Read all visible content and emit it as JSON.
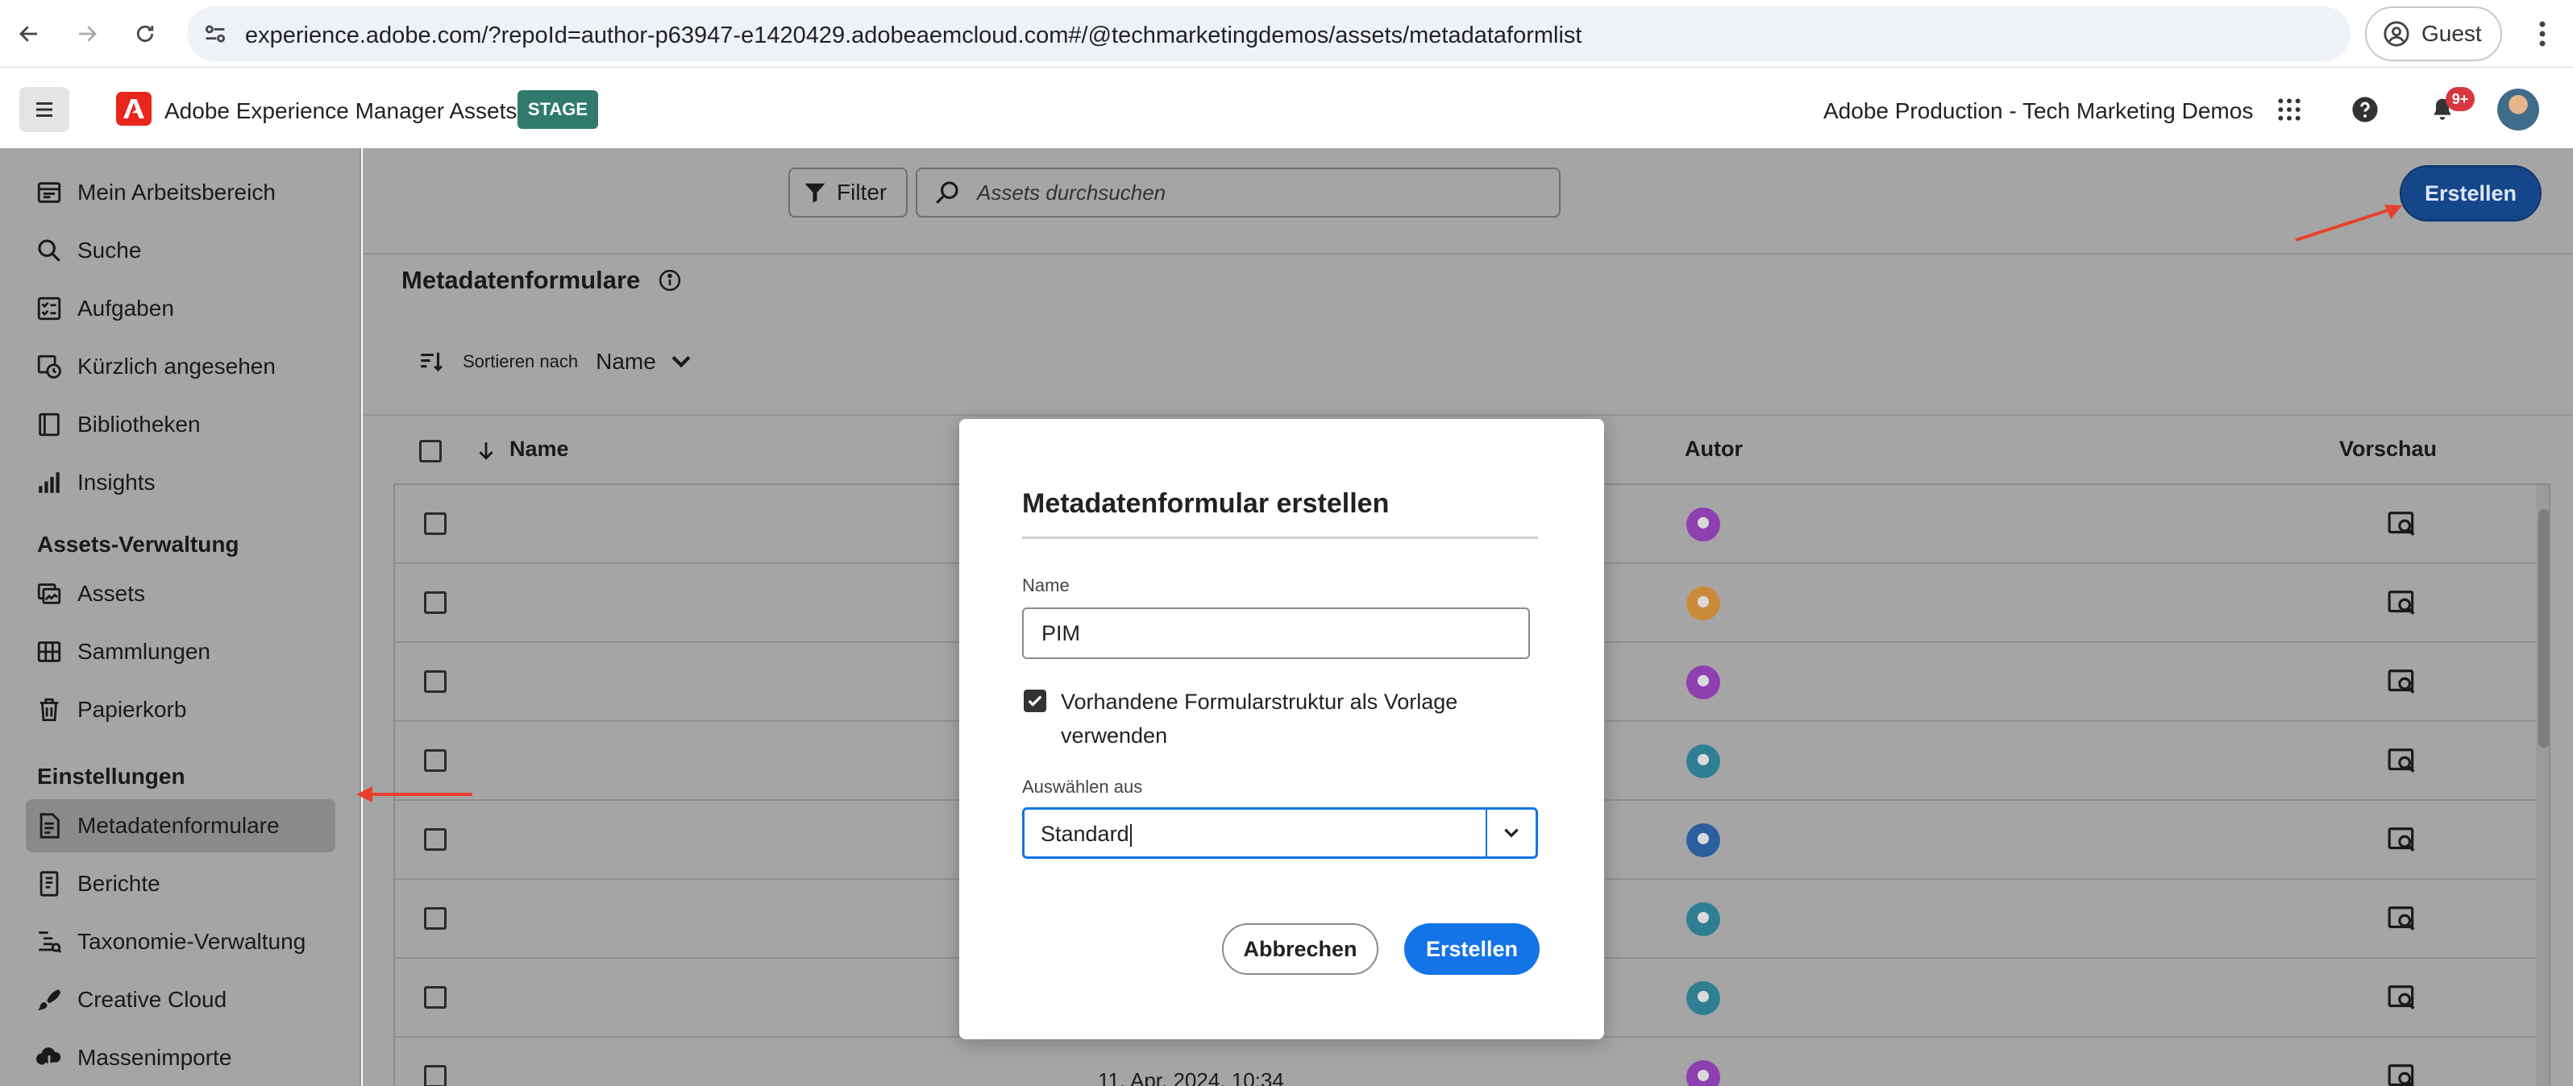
{
  "browser": {
    "url": "experience.adobe.com/?repoId=author-p63947-e1420429.adobeaemcloud.com#/@techmarketingdemos/assets/metadataformlist",
    "profile_label": "Guest"
  },
  "header": {
    "app_title": "Adobe Experience Manager Assets",
    "env_badge": "STAGE",
    "org_name": "Adobe Production - Tech Marketing Demos",
    "notification_count": "9+"
  },
  "sidebar": {
    "items_top": [
      {
        "label": "Mein Arbeitsbereich",
        "icon": "workspace-icon"
      },
      {
        "label": "Suche",
        "icon": "search-icon"
      },
      {
        "label": "Aufgaben",
        "icon": "tasks-icon"
      },
      {
        "label": "Kürzlich angesehen",
        "icon": "recent-icon"
      },
      {
        "label": "Bibliotheken",
        "icon": "library-icon"
      },
      {
        "label": "Insights",
        "icon": "insights-icon"
      }
    ],
    "section_assets": "Assets-Verwaltung",
    "items_assets": [
      {
        "label": "Assets",
        "icon": "assets-icon"
      },
      {
        "label": "Sammlungen",
        "icon": "collections-icon"
      },
      {
        "label": "Papierkorb",
        "icon": "trash-icon"
      }
    ],
    "section_settings": "Einstellungen",
    "items_settings": [
      {
        "label": "Metadatenformulare",
        "icon": "form-icon",
        "active": true
      },
      {
        "label": "Berichte",
        "icon": "reports-icon"
      },
      {
        "label": "Taxonomie-Verwaltung",
        "icon": "taxonomy-icon"
      },
      {
        "label": "Creative Cloud",
        "icon": "creative-cloud-icon"
      },
      {
        "label": "Massenimporte",
        "icon": "bulk-import-icon"
      }
    ]
  },
  "toolbar": {
    "filter_label": "Filter",
    "search_placeholder": "Assets durchsuchen",
    "create_label": "Erstellen"
  },
  "page": {
    "title": "Metadatenformulare",
    "sort_label": "Sortieren nach",
    "sort_value": "Name"
  },
  "table": {
    "columns": {
      "name": "Name",
      "author": "Autor",
      "preview": "Vorschau"
    },
    "rows": [
      {
        "date": "",
        "avatar_color": "#8e3fb0"
      },
      {
        "date": "",
        "avatar_color": "#c98a3a"
      },
      {
        "date": "",
        "avatar_color": "#8e3fb0"
      },
      {
        "date": "",
        "avatar_color": "#2f7f93"
      },
      {
        "date": "",
        "avatar_color": "#2c5fa0"
      },
      {
        "date": "",
        "avatar_color": "#2f7f93"
      },
      {
        "date": "",
        "avatar_color": "#2f7f93"
      },
      {
        "date": "11. Apr. 2024, 10:34",
        "avatar_color": "#8e3fb0"
      }
    ]
  },
  "dialog": {
    "title": "Metadatenformular erstellen",
    "name_label": "Name",
    "name_value": "PIM",
    "checkbox_label": "Vorhandene Formularstruktur als Vorlage verwenden",
    "select_label": "Auswählen aus",
    "select_value": "Standard",
    "cancel_label": "Abbrechen",
    "create_label": "Erstellen"
  },
  "colors": {
    "accent": "#1473e6",
    "annotation_arrow": "#e8402c",
    "overlay": "#a5a5a5"
  }
}
